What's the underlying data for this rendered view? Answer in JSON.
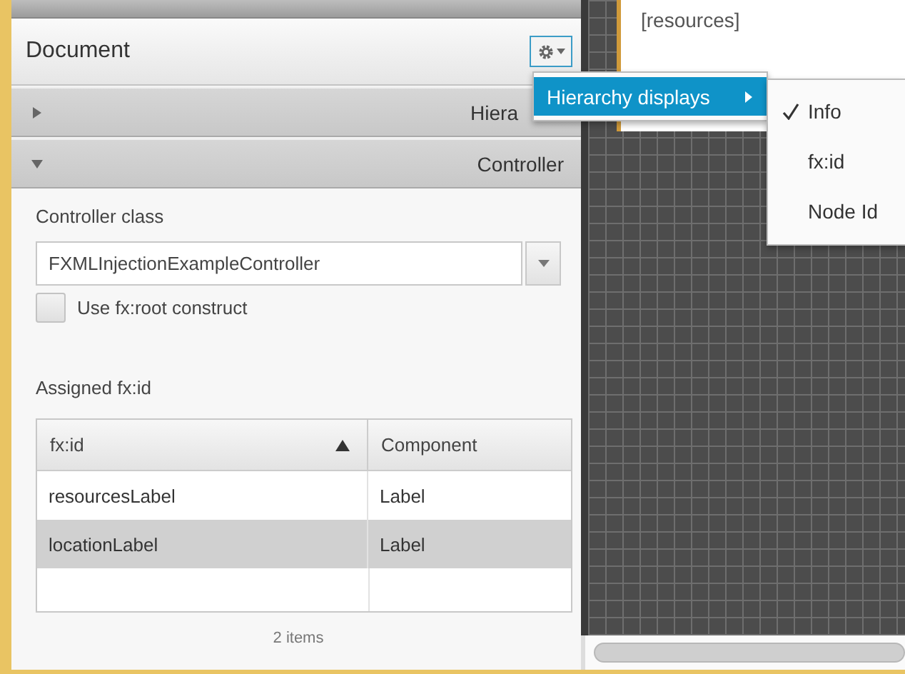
{
  "document_panel": {
    "title": "Document",
    "sections": [
      {
        "label": "Hiera",
        "expanded": false
      },
      {
        "label": "Controller",
        "expanded": true
      }
    ],
    "controller_class": {
      "label": "Controller class",
      "value": "FXMLInjectionExampleController"
    },
    "fxroot_checkbox": {
      "label": "Use fx:root construct",
      "checked": false
    },
    "assigned": {
      "label": "Assigned fx:id",
      "columns": [
        {
          "label": "fx:id",
          "sorted": true
        },
        {
          "label": "Component",
          "sorted": false
        }
      ],
      "rows": [
        {
          "cells": [
            "resourcesLabel",
            "Label"
          ],
          "selected": false
        },
        {
          "cells": [
            "locationLabel",
            "Label"
          ],
          "selected": true
        }
      ],
      "footer": "2 items"
    }
  },
  "canvas": {
    "component_label": "[resources]"
  },
  "menu": {
    "items": [
      {
        "label": "Hierarchy displays",
        "selected": true,
        "submenu": [
          {
            "label": "Info",
            "checked": true
          },
          {
            "label": "fx:id",
            "checked": false
          },
          {
            "label": "Node Id",
            "checked": false
          }
        ]
      }
    ]
  }
}
